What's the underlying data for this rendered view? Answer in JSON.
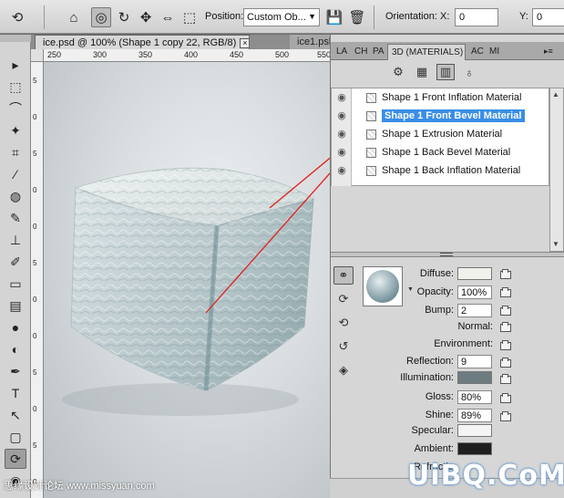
{
  "options_bar": {
    "position_label": "Position:",
    "position_value": "Custom Ob...",
    "orientation_label": "Orientation:",
    "x_label": "X:",
    "x_value": "0",
    "y_label": "Y:",
    "y_value": "0"
  },
  "document": {
    "active_tab": "ice.psd @ 100% (Shape 1 copy 22, RGB/8)",
    "inactive_tab": "ice1.psb @ 6...",
    "close_glyph": "×",
    "ruler_top_ticks": [
      "250",
      "300",
      "350",
      "400",
      "450",
      "500",
      "550"
    ],
    "ruler_left_ticks": [
      "5",
      "0",
      "5",
      "0",
      "0",
      "5",
      "0",
      "0",
      "5",
      "0",
      "5",
      "0"
    ]
  },
  "panel": {
    "tabs": [
      "LA",
      "CH",
      "PA",
      "3D (MATERIALS)",
      "AC",
      "MI"
    ],
    "materials": [
      {
        "label": "Shape 1 Front Inflation Material",
        "selected": false
      },
      {
        "label": "Shape 1 Front Bevel Material",
        "selected": true
      },
      {
        "label": "Shape 1 Extrusion Material",
        "selected": false
      },
      {
        "label": "Shape 1 Back Bevel Material",
        "selected": false
      },
      {
        "label": "Shape 1 Back Inflation Material",
        "selected": false
      }
    ],
    "properties": {
      "diffuse_label": "Diffuse:",
      "opacity_label": "Opacity:",
      "opacity_value": "100%",
      "bump_label": "Bump:",
      "bump_value": "2",
      "normal_label": "Normal:",
      "environment_label": "Environment:",
      "reflection_label": "Reflection:",
      "reflection_value": "9",
      "illumination_label": "Illumination:",
      "gloss_label": "Gloss:",
      "gloss_value": "80%",
      "shine_label": "Shine:",
      "shine_value": "89%",
      "specular_label": "Specular:",
      "ambient_label": "Ambient:",
      "refraction_label": "Refractio"
    },
    "colors": {
      "diffuse": "#f1f1ec",
      "illumination": "#6d7c80",
      "specular": "#f4f4f4",
      "ambient": "#1f1f1f",
      "selection": "#3a8ee6",
      "annotation_line": "#e02020"
    }
  },
  "watermarks": {
    "left": "思缘设计论坛 www.missyuan.com",
    "right": "UiBQ.CoM"
  }
}
